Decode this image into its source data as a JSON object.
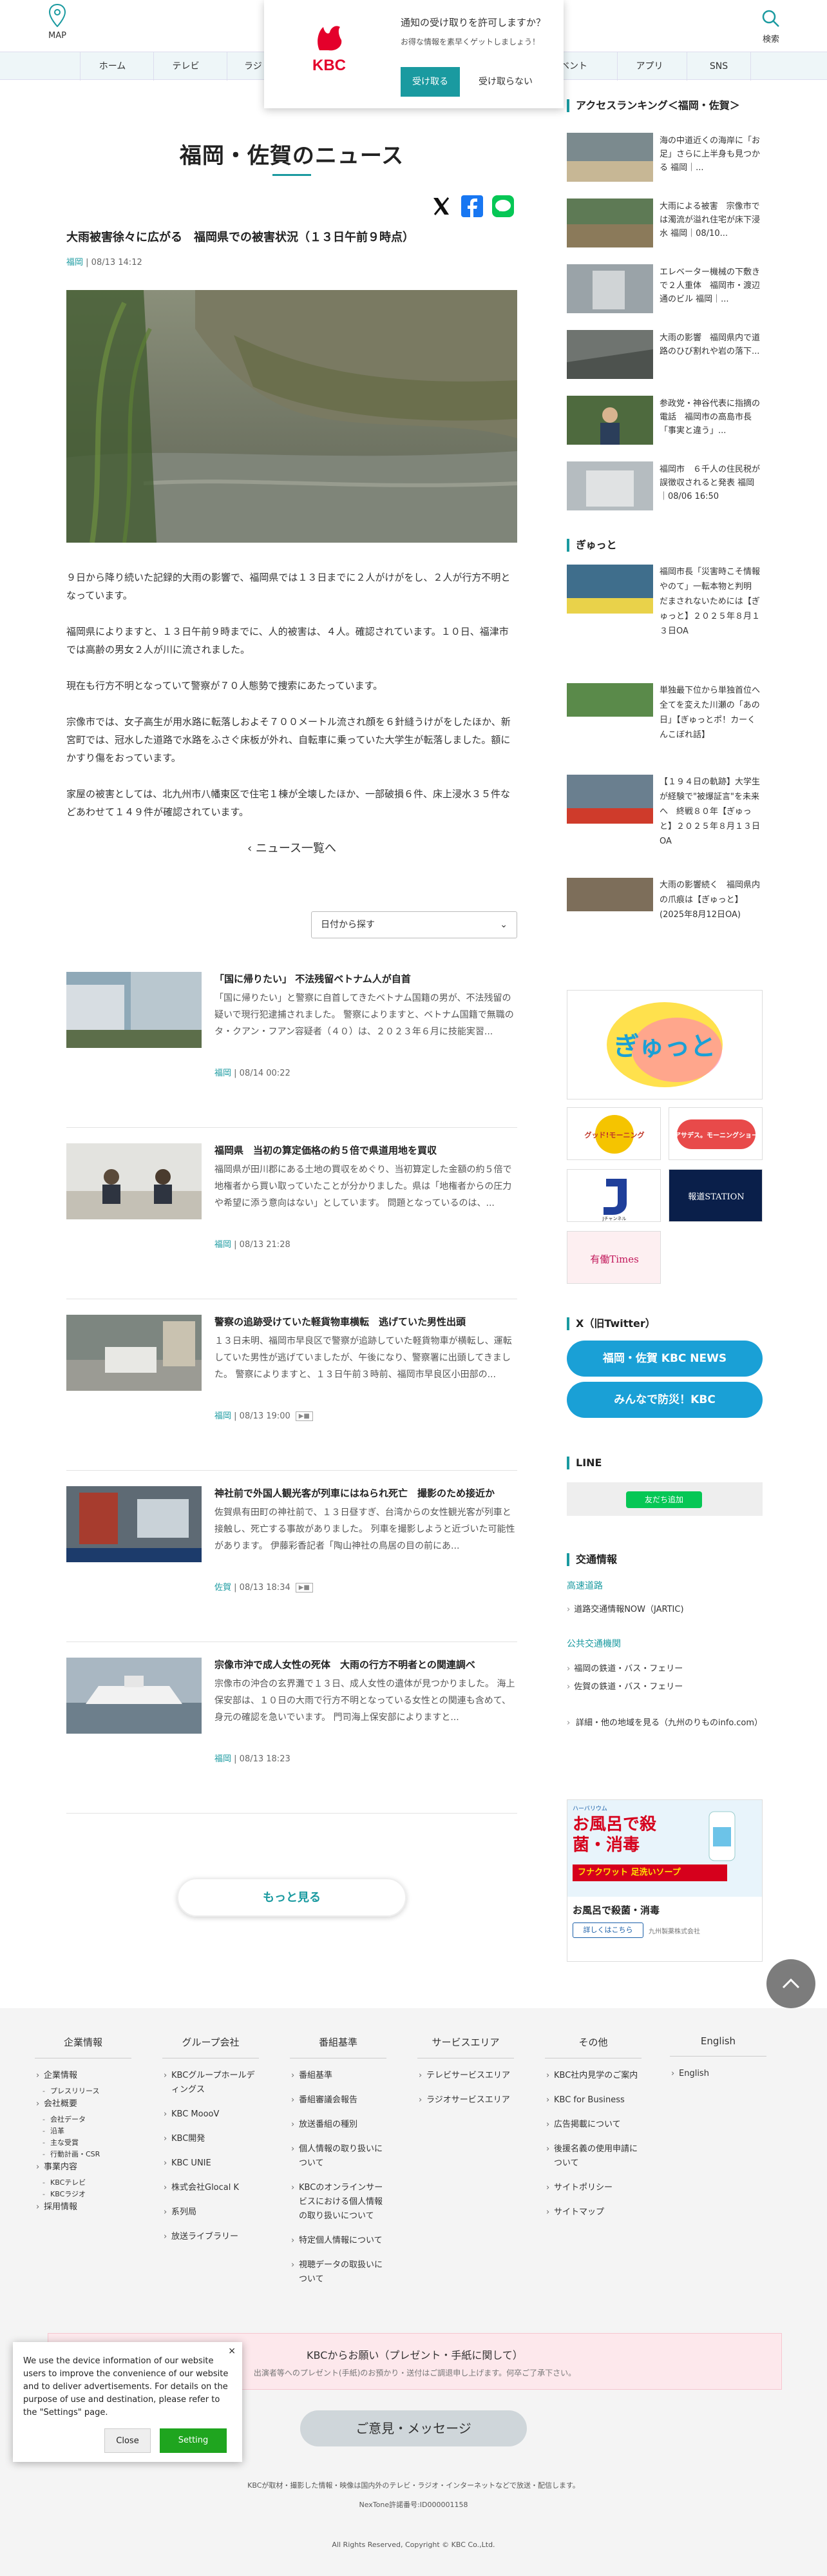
{
  "header": {
    "map_label": "MAP",
    "search_label": "検索"
  },
  "nav": [
    "ホーム",
    "テレビ",
    "ラジ",
    "ベント",
    "アプリ",
    "SNS"
  ],
  "notification": {
    "logo": "KBC",
    "title": "通知の受け取りを許可しますか？",
    "desc": "お得な情報を素早くゲットしましょう！",
    "accept": "受け取る",
    "decline": "受け取らない"
  },
  "page_title": "福岡・佐賀のニュース",
  "article": {
    "title": "大雨被害徐々に広がる　福岡県での被害状況（１３日午前９時点）",
    "category": "福岡",
    "date": "08/13 14:12",
    "paragraphs": [
      "９日から降り続いた記録的大雨の影響で、福岡県では１３日までに２人がけがをし、２人が行方不明となっています。",
      "福岡県によりますと、１３日午前９時までに、人的被害は、４人。確認されています。１０日、福津市では高齢の男女２人が川に流されました。",
      "現在も行方不明となっていて警察が７０人態勢で捜索にあたっています。",
      "宗像市では、女子高生が用水路に転落しおよそ７００メートル流され顔を６針縫うけがをしたほか、新宮町では、冠水した道路で水路をふさぐ床板が外れ、自転車に乗っていた大学生が転落しました。額にかすり傷をおっています。",
      "家屋の被害としては、北九州市八幡東区で住宅１棟が全壊したほか、一部破損６件、床上浸水３５件などあわせて１４９件が確認されています。"
    ]
  },
  "back_label": "ニュース一覧へ",
  "date_select": "日付から探す",
  "news_list": [
    {
      "title": "「国に帰りたい」 不法残留ベトナム人が自首",
      "summary": "「国に帰りたい」と警察に自首してきたベトナム国籍の男が、不法残留の疑いで現行犯逮捕されました。 警察によりますと、ベトナム国籍で無職のタ・クアン・フアン容疑者（４０）は、２０２３年６月に技能実習...",
      "category": "福岡",
      "date": "08/14 00:22",
      "video": false
    },
    {
      "title": "福岡県　当初の算定価格の約５倍で県道用地を買収",
      "summary": "福岡県が田川郡にある土地の買収をめぐり、当初算定した金額の約５倍で地権者から買い取っていたことが分かりました。県は「地権者からの圧力や希望に添う意向はない」としています。 問題となっているのは、...",
      "category": "福岡",
      "date": "08/13 21:28",
      "video": false
    },
    {
      "title": "警察の追跡受けていた軽貨物車横転　逃げていた男性出頭",
      "summary": "１３日未明、福岡市早良区で警察が追跡していた軽貨物車が横転し、運転していた男性が逃げていましたが、午後になり、警察署に出頭してきました。 警察によりますと、１３日午前３時前、福岡市早良区小田部の...",
      "category": "福岡",
      "date": "08/13 19:00",
      "video": true
    },
    {
      "title": "神社前で外国人観光客が列車にはねられ死亡　撮影のため接近か",
      "summary": "佐賀県有田町の神社前で、１３日昼すぎ、台湾からの女性観光客が列車と接触し、死亡する事故がありました。 列車を撮影しようと近づいた可能性があります。 伊藤彩香記者「陶山神社の鳥居の目の前にあ...",
      "category": "佐賀",
      "date": "08/13 18:34",
      "video": true
    },
    {
      "title": "宗像市沖で成人女性の死体　大雨の行方不明者との関連調べ",
      "summary": "宗像市の沖合の玄界灘で１３日、成人女性の遺体が見つかりました。 海上保安部は、１０日の大雨で行方不明となっている女性との関連も含めて、身元の確認を急いでいます。 門司海上保安部によりますと...",
      "category": "福岡",
      "date": "08/13 18:23",
      "video": false
    }
  ],
  "more_label": "もっと見る",
  "sidebar": {
    "ranking_title": "アクセスランキング＜福岡・佐賀＞",
    "ranking": [
      "海の中道近くの海岸に「お足」さらに上半身も見つかる 福岡｜...",
      "大雨による被害　宗像市では濁流が溢れ住宅が床下浸水 福岡｜08/10...",
      "エレベーター機械の下敷きで２人重体　福岡市・渡辺通のビル 福岡｜...",
      "大雨の影響　福岡県内で道路のひび割れや岩の落下...",
      "参政党・神谷代表に指摘の電話　福岡市の高島市長「事実と違う」...",
      "福岡市　６千人の住民税が誤徴収されると発表 福岡｜08/06 16:50"
    ],
    "gyutto_title": "ぎゅっと",
    "gyutto": [
      "福岡市長「災害時こそ情報やのて」一転本物と判明　だまされないためには【ぎゅっと】２０２５年８月１３日OA",
      "単独最下位から単独首位へ 全てを変えた川瀬の「あの日」【ぎゅっとポ！カーくんこぼれ話】",
      "【１９４日の軌跡】大学生が経験で\"被爆証言\"を未来へ　終戦８０年【ぎゅっと】２０２５年８月１３日OA",
      "大雨の影響続く　福岡県内の爪痕は【ぎゅっと】(2025年8月12日OA)"
    ],
    "banner_main": "ぎゅっと",
    "banners": [
      "グッド!モーニング",
      "アサデス。モーニングショー",
      "Jチャンネル",
      "報道STATION",
      "有働Times"
    ],
    "x_title": "X（旧Twitter）",
    "x_buttons": [
      "福岡・佐賀 KBC NEWS",
      "みんなで防災！KBC"
    ],
    "line_title": "LINE",
    "line_button": "友だち追加",
    "traffic_title": "交通情報",
    "traffic_road": "高速道路",
    "traffic_road_items": [
      "道路交通情報NOW（JARTIC)"
    ],
    "traffic_public": "公共交通機関",
    "traffic_public_items": [
      "福岡の鉄道・バス・フェリー",
      "佐賀の鉄道・バス・フェリー"
    ],
    "traffic_more": "詳細・他の地域を見る（九州のりものinfo.com）",
    "ad": {
      "brand": "ハーバリウム",
      "head": "お風呂で殺菌・消毒",
      "product": "フナクワット 足洗いソープ",
      "caption": "お風呂で殺菌・消毒",
      "btn": "詳しくはこちら",
      "company": "九州製薬株式会社"
    }
  },
  "footer": {
    "cols": [
      {
        "title": "企業情報",
        "items": [
          "企業情報",
          "プレスリリース",
          "会社概要",
          "会社データ",
          "沿革",
          "主な受賞",
          "行動計画・CSR",
          "事業内容",
          "KBCテレビ",
          "KBCラジオ",
          "採用情報"
        ]
      },
      {
        "title": "グループ会社",
        "items": [
          "KBCグループホールディングス",
          "KBC MoooV",
          "KBC開発",
          "KBC UNIE",
          "株式会社Glocal K",
          "系列局",
          "放送ライブラリー"
        ]
      },
      {
        "title": "番組基準",
        "items": [
          "番組基準",
          "番組審議会報告",
          "放送番組の種別",
          "個人情報の取り扱いについて",
          "KBCのオンラインサービスにおける個人情報の取り扱いについて",
          "特定個人情報について",
          "視聴データの取扱いについて"
        ]
      },
      {
        "title": "サービスエリア",
        "items": [
          "テレビサービスエリア",
          "ラジオサービスエリア"
        ]
      },
      {
        "title": "その他",
        "items": [
          "KBC社内見学のご案内",
          "KBC for Business",
          "広告掲載について",
          "後援名義の使用申請について",
          "サイトポリシー",
          "サイトマップ"
        ]
      },
      {
        "title": "English",
        "items": [
          "English"
        ]
      }
    ],
    "present_title": "KBCからお願い（プレゼント・手紙に関して）",
    "present_desc": "出演者等へのプレゼント(手紙)のお預かり・送付はご調退申し上げます。何卒ご了承下さい。",
    "opinion": "ご意見・メッセージ",
    "note1": "KBCが取材・撮影した情報・映像は国内外のテレビ・ラジオ・インターネットなどで放送・配信します。",
    "note2": "NexTone許諾番号:ID000001158",
    "copyright": "All Rights Reserved, Copyright © KBC Co.,Ltd."
  },
  "cookie": {
    "text": "We use the device information of our website users to improve the convenience of our website and to deliver advertisements. For details on the purpose of use and destination, please refer to the \"Settings\" page.",
    "close": "Close",
    "setting": "Setting"
  },
  "colors": {
    "accent": "#1a9aa0",
    "x_button": "#1aa0d6",
    "line": "#06c755",
    "logo_red": "#e4002b"
  }
}
